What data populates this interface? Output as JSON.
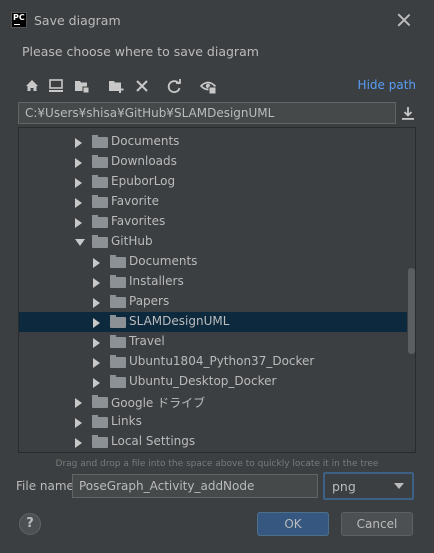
{
  "window": {
    "title": "Save diagram",
    "logo_text": "PC"
  },
  "prompt": "Please choose where to save diagram",
  "toolbar": {
    "icons": [
      "home-icon",
      "desktop-icon",
      "project-folder-icon",
      "new-folder-icon",
      "delete-icon",
      "refresh-icon",
      "show-hidden-icon"
    ],
    "hide_path_label": "Hide path"
  },
  "path": {
    "value": "C:¥Users¥shisa¥GitHub¥SLAMDesignUML"
  },
  "tree": {
    "items": [
      {
        "label": "Documents",
        "level": 0,
        "expanded": false,
        "selected": false
      },
      {
        "label": "Downloads",
        "level": 0,
        "expanded": false,
        "selected": false
      },
      {
        "label": "EpuborLog",
        "level": 0,
        "expanded": false,
        "selected": false
      },
      {
        "label": "Favorite",
        "level": 0,
        "expanded": false,
        "selected": false
      },
      {
        "label": "Favorites",
        "level": 0,
        "expanded": false,
        "selected": false
      },
      {
        "label": "GitHub",
        "level": 0,
        "expanded": true,
        "selected": false
      },
      {
        "label": "Documents",
        "level": 1,
        "expanded": false,
        "selected": false
      },
      {
        "label": "Installers",
        "level": 1,
        "expanded": false,
        "selected": false
      },
      {
        "label": "Papers",
        "level": 1,
        "expanded": false,
        "selected": false
      },
      {
        "label": "SLAMDesignUML",
        "level": 1,
        "expanded": false,
        "selected": true
      },
      {
        "label": "Travel",
        "level": 1,
        "expanded": false,
        "selected": false
      },
      {
        "label": "Ubuntu1804_Python37_Docker",
        "level": 1,
        "expanded": false,
        "selected": false
      },
      {
        "label": "Ubuntu_Desktop_Docker",
        "level": 1,
        "expanded": false,
        "selected": false
      },
      {
        "label": "Google ドライブ",
        "level": 0,
        "expanded": false,
        "selected": false
      },
      {
        "label": "Links",
        "level": 0,
        "expanded": false,
        "selected": false
      },
      {
        "label": "Local Settings",
        "level": 0,
        "expanded": false,
        "selected": false
      }
    ]
  },
  "hint": "Drag and drop a file into the space above to quickly locate it in the tree",
  "filename": {
    "label": "File name:",
    "value": "PoseGraph_Activity_addNode"
  },
  "format": {
    "selected": "png"
  },
  "buttons": {
    "help": "?",
    "ok": "OK",
    "cancel": "Cancel"
  },
  "colors": {
    "background": "#3c3f41",
    "accent": "#365880",
    "link": "#589df6",
    "selection": "#0d293e"
  }
}
